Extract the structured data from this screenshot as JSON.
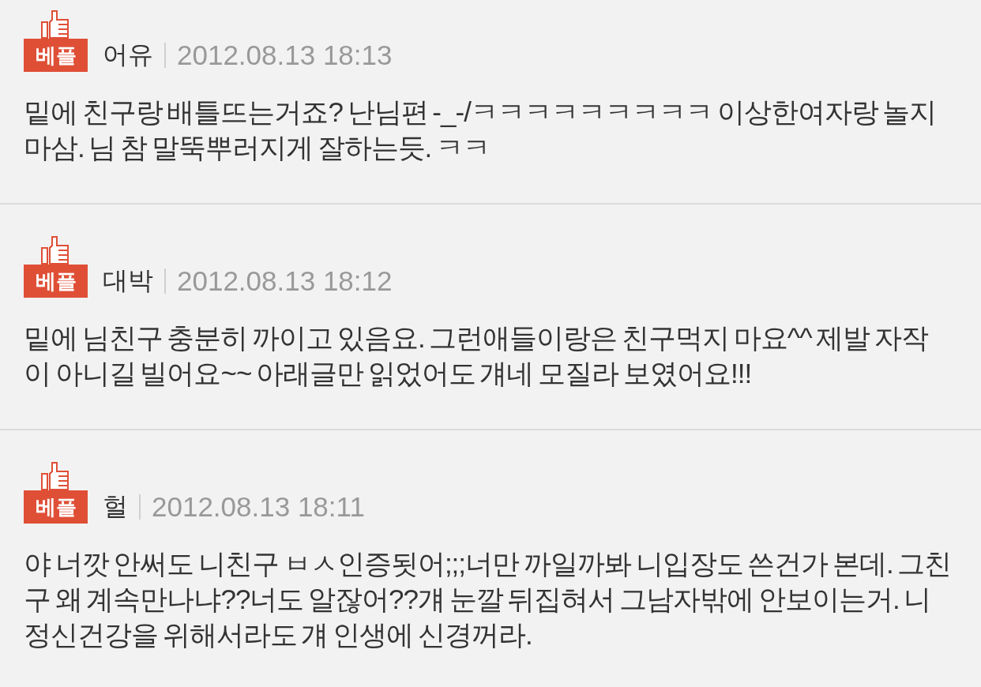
{
  "comments": [
    {
      "badge": "베플",
      "author": "어유",
      "time": "2012.08.13 18:13",
      "text": "밑에 친구랑 배틀뜨는거죠? 난님편 -_-/ㅋㅋㅋㅋㅋㅋㅋㅋㅋ 이상한여자랑 놀지마삼. 님 참 말뚝뿌러지게 잘하는듯. ㅋㅋ"
    },
    {
      "badge": "베플",
      "author": "대박",
      "time": "2012.08.13 18:12",
      "text": "밑에 님친구 충분히 까이고 있음요. 그런애들이랑은 친구먹지 마요^^ 제발 자작이 아니길 빌어요~~ 아래글만 읽었어도 걔네 모질라 보였어요!!!"
    },
    {
      "badge": "베플",
      "author": "헐",
      "time": "2012.08.13 18:11",
      "text": "야 너깟 안써도 니친구 ㅂㅅ인증됫어;;;너만 까일까봐 니입장도 쓴건가 본데. 그친구 왜 계속만나냐??너도 알잖어??걔 눈깔 뒤집혀서 그남자밖에 안보이는거. 니 정신건강을 위해서라도 걔 인생에 신경꺼라."
    }
  ]
}
